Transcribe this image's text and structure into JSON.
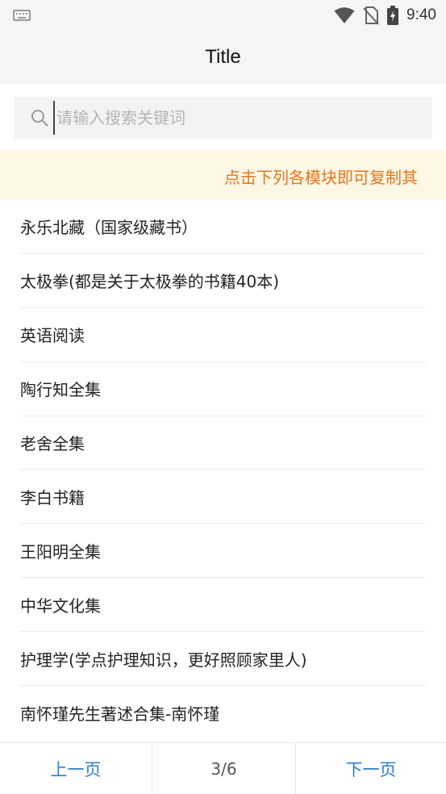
{
  "status_bar": {
    "time": "9:40",
    "icons": [
      "keyboard-icon",
      "wifi-icon",
      "no-sim-icon",
      "battery-charging-icon"
    ]
  },
  "header": {
    "title": "Title"
  },
  "search": {
    "placeholder": "请输入搜索关键词",
    "value": ""
  },
  "notice": {
    "text": "点击下列各模块即可复制其"
  },
  "books": [
    {
      "label": "永乐北藏（国家级藏书）"
    },
    {
      "label": "太极拳(都是关于太极拳的书籍40本)"
    },
    {
      "label": "英语阅读"
    },
    {
      "label": "陶行知全集"
    },
    {
      "label": "老舍全集"
    },
    {
      "label": "李白书籍"
    },
    {
      "label": "王阳明全集"
    },
    {
      "label": "中华文化集"
    },
    {
      "label": "护理学(学点护理知识，更好照顾家里人)"
    },
    {
      "label": "南怀瑾先生著述合集-南怀瑾"
    }
  ],
  "pager": {
    "prev_label": "上一页",
    "next_label": "下一页",
    "indicator": "3/6"
  },
  "colors": {
    "notice_bg": "#fff7e6",
    "notice_text": "#e8751a",
    "link_blue": "#2a7fd4"
  }
}
